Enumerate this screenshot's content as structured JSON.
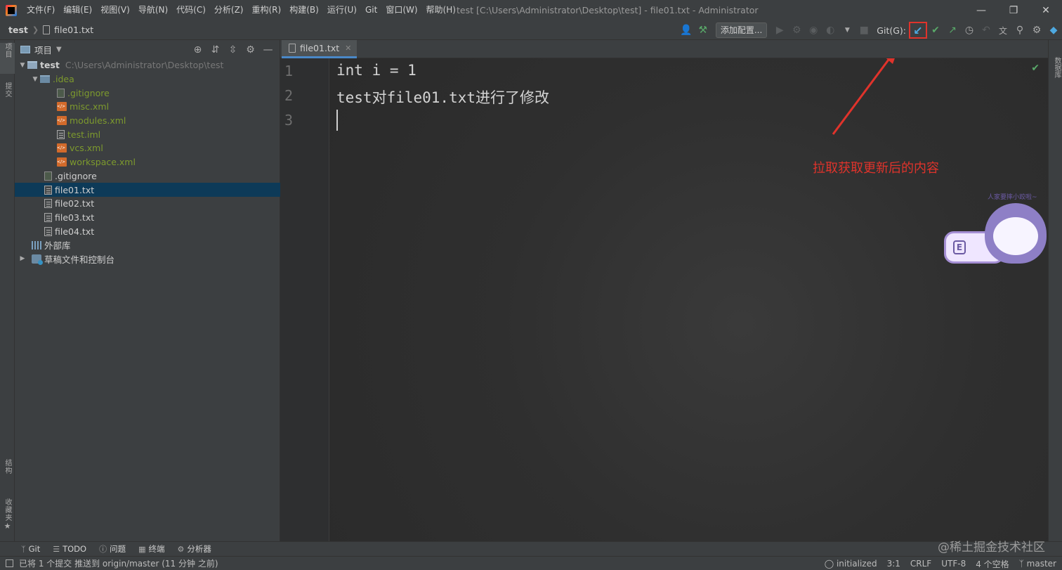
{
  "app": {
    "menu": [
      "文件(F)",
      "编辑(E)",
      "视图(V)",
      "导航(N)",
      "代码(C)",
      "分析(Z)",
      "重构(R)",
      "构建(B)",
      "运行(U)",
      "Git",
      "窗口(W)",
      "帮助(H)"
    ],
    "window_title": "test [C:\\Users\\Administrator\\Desktop\\test] - file01.txt - Administrator"
  },
  "breadcrumb": {
    "root": "test",
    "file": "file01.txt"
  },
  "toolbar": {
    "add_config": "添加配置...",
    "git_label": "Git(G):"
  },
  "left_strip": {
    "project": "项目",
    "commit": "提交",
    "structure": "结构",
    "favorites": "收藏夹"
  },
  "project_panel": {
    "title": "项目",
    "root_name": "test",
    "root_path": "C:\\Users\\Administrator\\Desktop\\test",
    "idea_folder": ".idea",
    "idea_files": [
      ".gitignore",
      "misc.xml",
      "modules.xml",
      "test.iml",
      "vcs.xml",
      "workspace.xml"
    ],
    "root_files": [
      ".gitignore",
      "file01.txt",
      "file02.txt",
      "file03.txt",
      "file04.txt"
    ],
    "external_libs": "外部库",
    "scratches": "草稿文件和控制台"
  },
  "editor": {
    "tab": "file01.txt",
    "line_numbers": [
      "1",
      "2",
      "3"
    ],
    "lines": [
      "int i = 1",
      "test对file01.txt进行了修改",
      ""
    ]
  },
  "annotation": {
    "text": "拉取获取更新后的内容",
    "color": "#e0332b"
  },
  "sticker": {
    "text": "人家要摔小跤啦~"
  },
  "right_strip": {
    "label": "数据库"
  },
  "tool_windows": [
    "Git",
    "TODO",
    "问题",
    "终端",
    "分析器"
  ],
  "watermark": "@稀土掘金技术社区",
  "statusbar": {
    "message": "已将 1 个提交 推送到 origin/master (11 分钟 之前)",
    "branch_status": "initialized",
    "position": "3:1",
    "line_sep": "CRLF",
    "encoding": "UTF-8",
    "indent": "4 个空格",
    "branch": "master"
  }
}
